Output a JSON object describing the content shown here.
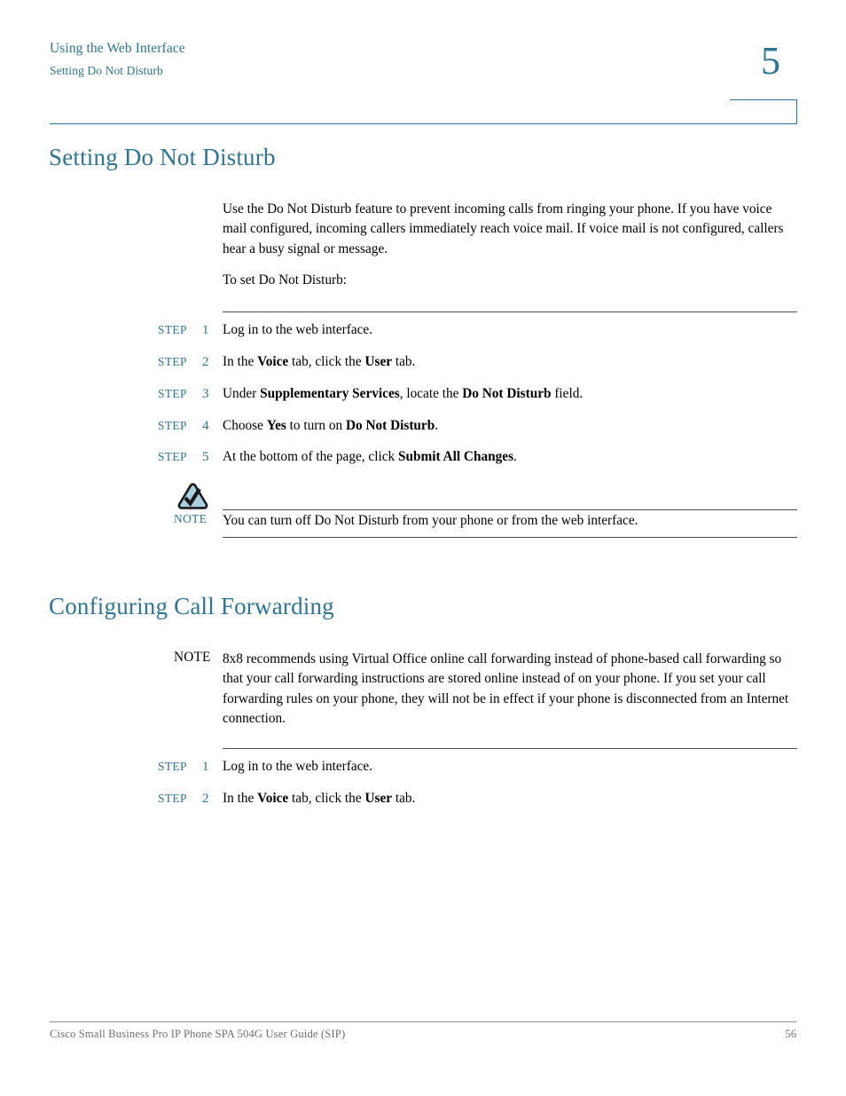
{
  "colors": {
    "accent": "#2b7596",
    "note_icon_fill": "#a9cfe0",
    "note_icon_stroke": "#1a1a1a",
    "rule": "#4d4d4d",
    "footer_text": "#6f6f6f"
  },
  "header": {
    "chapter_name": "Using the Web Interface",
    "section_name": "Setting Do Not Disturb",
    "chapter_number": "5"
  },
  "sections": {
    "dnd": {
      "heading": "Setting Do Not Disturb",
      "intro_paragraph": "Use the Do Not Disturb feature to prevent incoming calls from ringing your phone. If you have voice mail configured, incoming callers immediately reach voice mail. If voice mail is not configured, callers hear a busy signal or message.",
      "lead_in": "To set Do Not Disturb:",
      "steps": [
        {
          "label": "STEP",
          "number": "1",
          "text": "Log in to the web interface."
        },
        {
          "label": "STEP",
          "number": "2",
          "text": "In the Voice tab, click the User tab."
        },
        {
          "label": "STEP",
          "number": "3",
          "text": "Under Supplementary Services, locate the Do Not Disturb field."
        },
        {
          "label": "STEP",
          "number": "4",
          "text": "Choose Yes to turn on Do Not Disturb."
        },
        {
          "label": "STEP",
          "number": "5",
          "text": "At the bottom of the page, click Submit All Changes."
        }
      ],
      "note": {
        "icon": "note-triangle-check-icon",
        "label": "NOTE",
        "text": "You can turn off Do Not Disturb from your phone or from the web interface."
      }
    },
    "call_forwarding": {
      "heading": "Configuring Call Forwarding",
      "note": {
        "label": "NOTE",
        "text": "8x8 recommends using Virtual Office online call forwarding instead of phone-based call forwarding so that your call forwarding instructions are stored online instead of on your phone. If you set your call forwarding rules on your phone, they will not be in effect if your phone is disconnected from an Internet connection."
      },
      "steps": [
        {
          "label": "STEP",
          "number": "1",
          "text": "Log in to the web interface."
        },
        {
          "label": "STEP",
          "number": "2",
          "text": "In the Voice tab, click the User tab."
        }
      ]
    }
  },
  "footer": {
    "document_title": "Cisco Small Business Pro IP Phone SPA 504G User Guide (SIP)",
    "page_number": "56"
  }
}
